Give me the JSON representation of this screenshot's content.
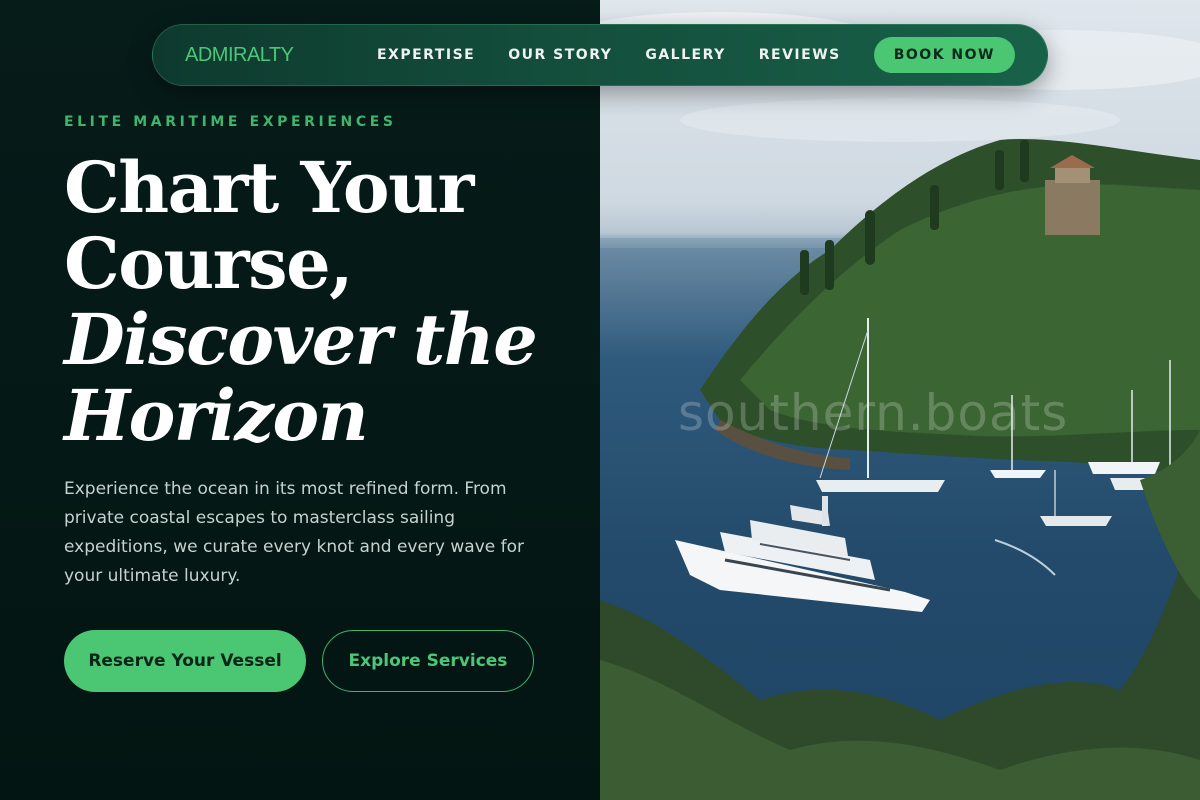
{
  "brand": {
    "name": "ADMIRALTY"
  },
  "nav": {
    "links": [
      "EXPERTISE",
      "OUR STORY",
      "GALLERY",
      "REVIEWS"
    ],
    "cta_label": "BOOK NOW"
  },
  "hero": {
    "eyebrow": "ELITE MARITIME EXPERIENCES",
    "headline_line1": "Chart Your",
    "headline_line2": "Course,",
    "headline_line3": "Discover the",
    "headline_line4": "Horizon",
    "lede": "Experience the ocean in its most refined form. From private coastal escapes to masterclass sailing expeditions, we curate every knot and every wave for your ultimate luxury.",
    "primary_cta": "Reserve Your Vessel",
    "secondary_cta": "Explore Services"
  },
  "photo": {
    "watermark": "southern.boats",
    "subject": "superyacht-in-coastal-bay"
  },
  "colors": {
    "accent": "#4bc673",
    "background": "#051a17",
    "nav_bg": "#14503d",
    "text_primary": "#ffffff",
    "text_body": "#c6d2ce"
  }
}
